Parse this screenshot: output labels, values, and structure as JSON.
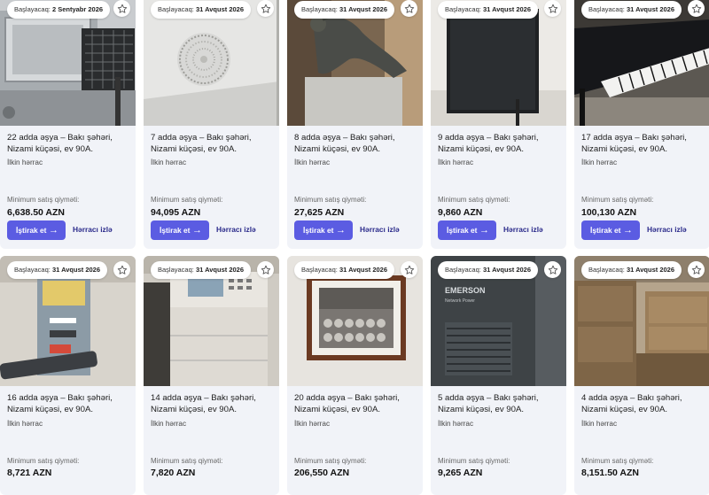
{
  "labels": {
    "starts_prefix": "Başlayacaq:",
    "starting_auction": "İlkin hərrac",
    "min_price_label": "Minimum satış qiyməti:",
    "bid_button": "İştirak et",
    "follow_link": "Hərracı izlə"
  },
  "icons": {
    "favorite": "star-outline-icon",
    "arrow": "arrow-right-icon"
  },
  "colors": {
    "accent": "#5b5ce2",
    "card_bg": "#f1f3f8"
  },
  "cards": [
    {
      "start_date": "2 Sentyabr 2026",
      "title": "22 adda əşya – Bakı şəhəri, Nizami küçəsi, ev 90A.",
      "price": "6,638.50 AZN"
    },
    {
      "start_date": "31 Avqust 2026",
      "title": "7 adda əşya – Bakı şəhəri, Nizami küçəsi, ev 90A.",
      "price": "94,095 AZN"
    },
    {
      "start_date": "31 Avqust 2026",
      "title": "8 adda əşya – Bakı şəhəri, Nizami küçəsi, ev 90A.",
      "price": "27,625 AZN"
    },
    {
      "start_date": "31 Avqust 2026",
      "title": "9 adda əşya – Bakı şəhəri, Nizami küçəsi, ev 90A.",
      "price": "9,860 AZN"
    },
    {
      "start_date": "31 Avqust 2026",
      "title": "17 adda əşya – Bakı şəhəri, Nizami küçəsi, ev 90A.",
      "price": "100,130 AZN"
    },
    {
      "start_date": "31 Avqust 2026",
      "title": "16 adda əşya – Bakı şəhəri, Nizami küçəsi, ev 90A.",
      "price": "8,721 AZN"
    },
    {
      "start_date": "31 Avqust 2026",
      "title": "14 adda əşya – Bakı şəhəri, Nizami küçəsi, ev 90A.",
      "price": "7,820 AZN"
    },
    {
      "start_date": "31 Avqust 2026",
      "title": "20 adda əşya – Bakı şəhəri, Nizami küçəsi, ev 90A.",
      "price": "206,550 AZN"
    },
    {
      "start_date": "31 Avqust 2026",
      "title": "5 adda əşya – Bakı şəhəri, Nizami küçəsi, ev 90A.",
      "price": "9,265 AZN"
    },
    {
      "start_date": "31 Avqust 2026",
      "title": "4 adda əşya – Bakı şəhəri, Nizami küçəsi, ev 90A.",
      "price": "8,151.50 AZN"
    }
  ]
}
